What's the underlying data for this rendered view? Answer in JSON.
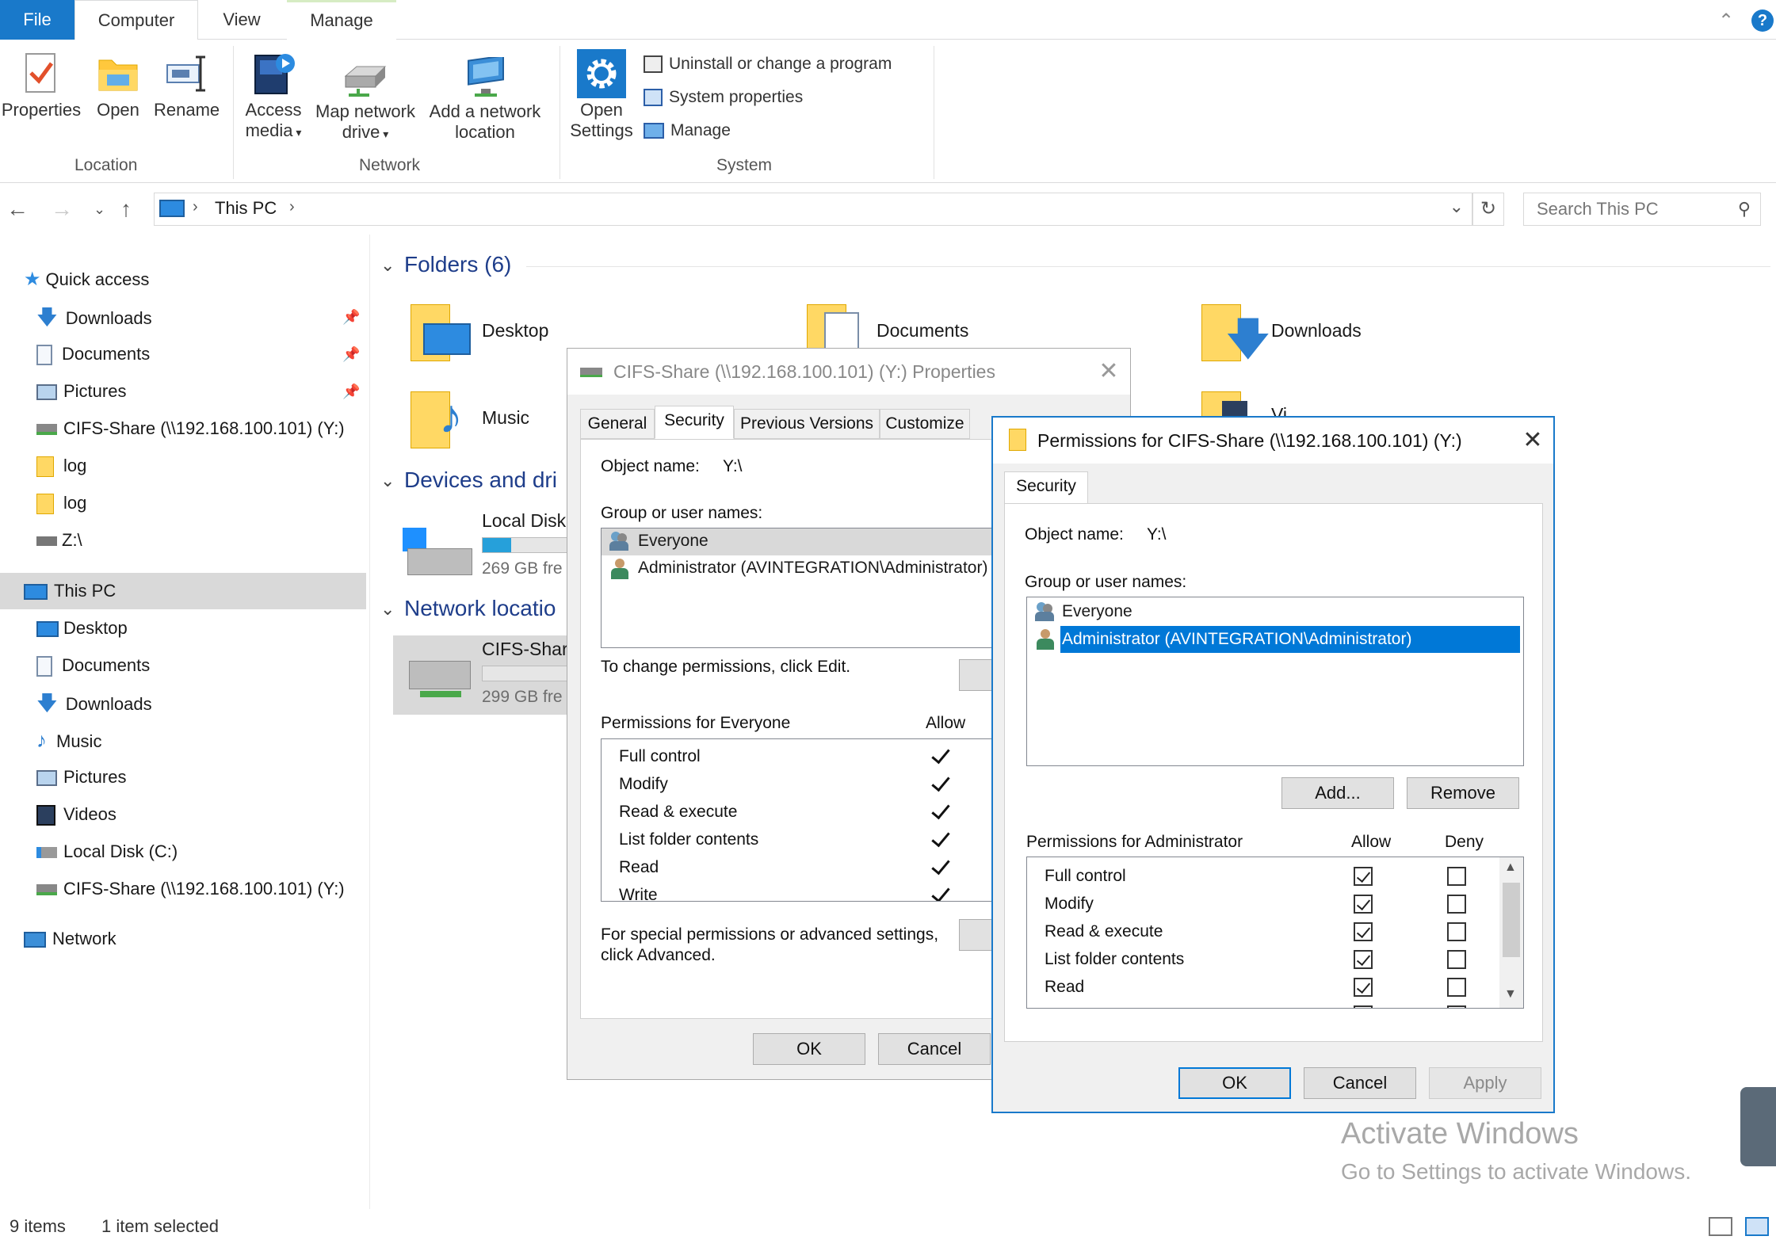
{
  "ribbon": {
    "tabs": {
      "file": "File",
      "computer": "Computer",
      "view": "View",
      "manage": "Manage"
    },
    "location": {
      "label": "Location",
      "properties": "Properties",
      "open": "Open",
      "rename": "Rename"
    },
    "network": {
      "label": "Network",
      "access_media_1": "Access",
      "access_media_2": "media",
      "map_drive_1": "Map network",
      "map_drive_2": "drive",
      "add_location_1": "Add a network",
      "add_location_2": "location"
    },
    "system": {
      "label": "System",
      "open_settings_1": "Open",
      "open_settings_2": "Settings",
      "uninstall": "Uninstall or change a program",
      "system_properties": "System properties",
      "manage": "Manage"
    }
  },
  "address": {
    "path_item": "This PC",
    "search_placeholder": "Search This PC"
  },
  "nav": {
    "quick_access": "Quick access",
    "quick_items": [
      "Downloads",
      "Documents",
      "Pictures",
      "CIFS-Share (\\\\192.168.100.101) (Y:)",
      "log",
      "log",
      "Z:\\"
    ],
    "this_pc": "This PC",
    "pc_items": [
      "Desktop",
      "Documents",
      "Downloads",
      "Music",
      "Pictures",
      "Videos",
      "Local Disk (C:)",
      "CIFS-Share (\\\\192.168.100.101) (Y:)"
    ],
    "network": "Network"
  },
  "content": {
    "folders_header": "Folders (6)",
    "folders": [
      "Desktop",
      "Documents",
      "Downloads",
      "Music",
      "Vi"
    ],
    "devices_header": "Devices and dri",
    "local_disk_name": "Local Disk",
    "local_disk_free": "269 GB fre",
    "network_header": "Network locatio",
    "cifs_name": "CIFS-Share",
    "cifs_free": "299 GB fre"
  },
  "props_dialog": {
    "title": "CIFS-Share (\\\\192.168.100.101) (Y:) Properties",
    "tabs": [
      "General",
      "Security",
      "Previous Versions",
      "Customize"
    ],
    "object_name_label": "Object name:",
    "object_name_value": "Y:\\",
    "group_label": "Group or user names:",
    "users": [
      "Everyone",
      "Administrator (AVINTEGRATION\\Administrator)"
    ],
    "change_text": "To change permissions, click Edit.",
    "perm_header": "Permissions for Everyone",
    "allow_header": "Allow",
    "perms": [
      "Full control",
      "Modify",
      "Read & execute",
      "List folder contents",
      "Read",
      "Write"
    ],
    "special_1": "For special permissions or advanced settings,",
    "special_2": "click Advanced.",
    "ok": "OK",
    "cancel": "Cancel"
  },
  "perm_dialog": {
    "title": "Permissions for CIFS-Share (\\\\192.168.100.101) (Y:)",
    "tab": "Security",
    "object_name_label": "Object name:",
    "object_name_value": "Y:\\",
    "group_label": "Group or user names:",
    "users": [
      "Everyone",
      "Administrator (AVINTEGRATION\\Administrator)"
    ],
    "add": "Add...",
    "remove": "Remove",
    "perm_header": "Permissions for Administrator",
    "allow_header": "Allow",
    "deny_header": "Deny",
    "perms": [
      "Full control",
      "Modify",
      "Read & execute",
      "List folder contents",
      "Read"
    ],
    "ok": "OK",
    "cancel": "Cancel",
    "apply": "Apply"
  },
  "watermark": {
    "line1": "Activate Windows",
    "line2": "Go to Settings to activate Windows."
  },
  "status": {
    "items": "9 items",
    "selected": "1 item selected"
  }
}
